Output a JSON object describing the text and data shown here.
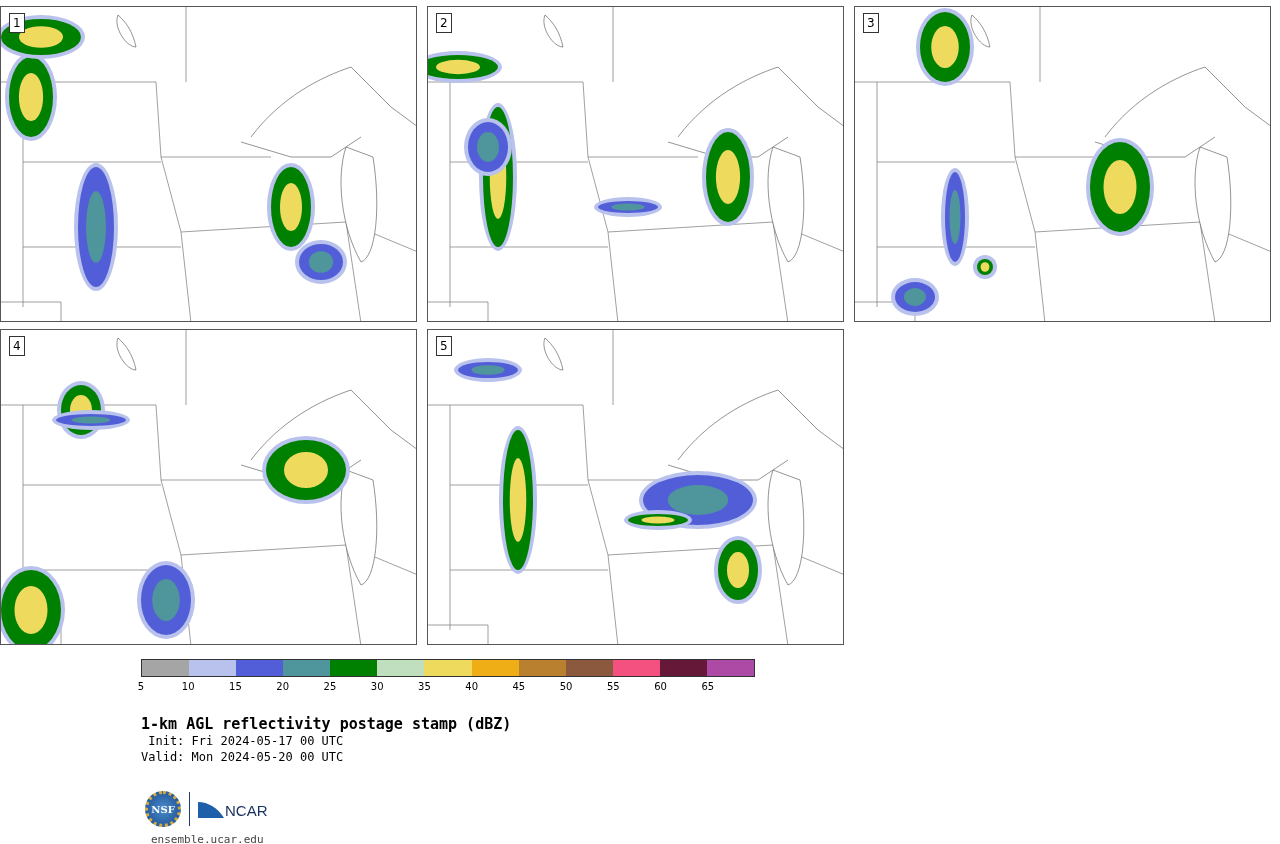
{
  "panels": [
    {
      "number": "1"
    },
    {
      "number": "2"
    },
    {
      "number": "3"
    },
    {
      "number": "4"
    },
    {
      "number": "5"
    }
  ],
  "colorbar": [
    {
      "label": "5",
      "color": "#a5a5a5"
    },
    {
      "label": "10",
      "color": "#b8c2ec"
    },
    {
      "label": "15",
      "color": "#525ed8"
    },
    {
      "label": "20",
      "color": "#4f959c"
    },
    {
      "label": "25",
      "color": "#008000"
    },
    {
      "label": "30",
      "color": "#bfdfbf"
    },
    {
      "label": "35",
      "color": "#eedb5e"
    },
    {
      "label": "40",
      "color": "#efad16"
    },
    {
      "label": "45",
      "color": "#b98030"
    },
    {
      "label": "50",
      "color": "#8b5a3e"
    },
    {
      "label": "55",
      "color": "#f45180"
    },
    {
      "label": "60",
      "color": "#651838"
    },
    {
      "label": "65",
      "color": "#ac4aa5"
    }
  ],
  "title": "1-km AGL reflectivity postage stamp (dBZ)",
  "init": " Init: Fri 2024-05-17 00 UTC",
  "valid": "Valid: Mon 2024-05-20 00 UTC",
  "logos": [
    "NSF",
    "NCAR"
  ],
  "site": "ensemble.ucar.edu"
}
